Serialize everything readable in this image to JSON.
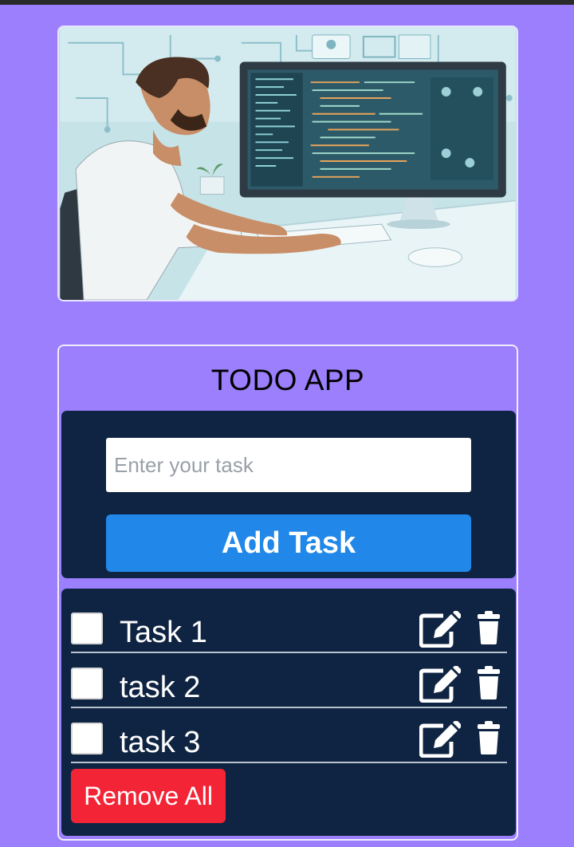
{
  "app": {
    "title": "TODO APP"
  },
  "form": {
    "placeholder": "Enter your task",
    "value": "",
    "add_label": "Add Task"
  },
  "tasks": [
    {
      "label": "Task 1",
      "checked": false
    },
    {
      "label": "task 2",
      "checked": false
    },
    {
      "label": "task 3",
      "checked": false
    }
  ],
  "actions": {
    "remove_all_label": "Remove All"
  },
  "icons": {
    "edit": "edit-square-pen-icon",
    "delete": "trash-can-icon"
  },
  "colors": {
    "page_background": "#9b7ffc",
    "panel": "#0f2442",
    "add_button": "#2187e8",
    "remove_button": "#f42437"
  }
}
